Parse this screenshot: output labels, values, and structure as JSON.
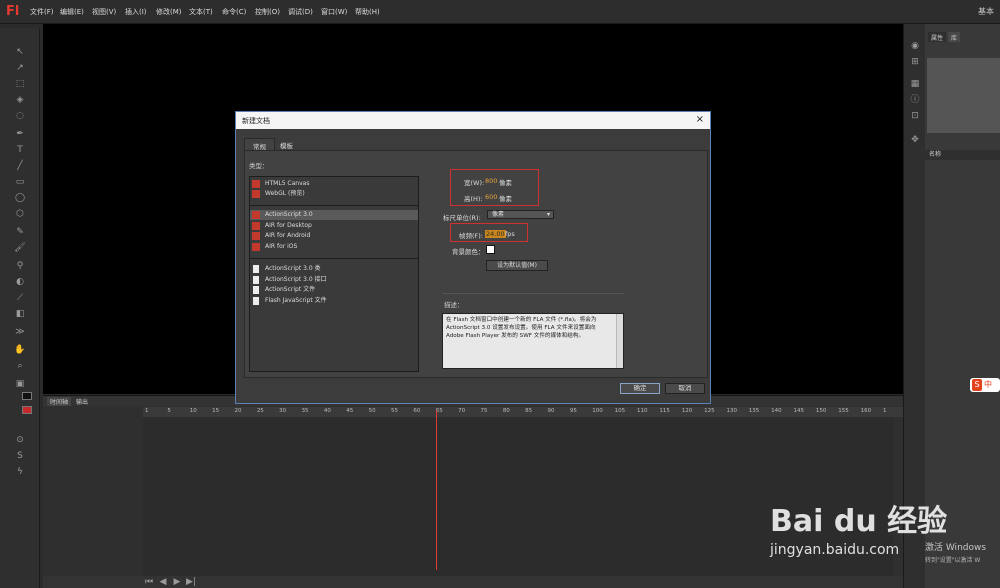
{
  "app": {
    "logo": "Fl",
    "workspace": "基本"
  },
  "menu": [
    "文件(F)",
    "编辑(E)",
    "视图(V)",
    "插入(I)",
    "修改(M)",
    "文本(T)",
    "命令(C)",
    "控制(O)",
    "调试(D)",
    "窗口(W)",
    "帮助(H)"
  ],
  "right_panel": {
    "tabs": [
      "属性",
      "库"
    ],
    "name_header": "名称"
  },
  "timeline": {
    "tabs": [
      "时间轴",
      "输出"
    ],
    "ruler": [
      "1",
      "5",
      "10",
      "15",
      "20",
      "25",
      "30",
      "35",
      "40",
      "45",
      "50",
      "55",
      "60",
      "65",
      "70",
      "75",
      "80",
      "85",
      "90",
      "95",
      "100",
      "105",
      "110",
      "115",
      "120",
      "125",
      "130",
      "135",
      "140",
      "145",
      "150",
      "155",
      "160",
      "1"
    ]
  },
  "dialog": {
    "title": "新建文档",
    "close": "×",
    "tabs": [
      "常规",
      "模板"
    ],
    "type_label": "类型：",
    "types_group1": [
      "HTML5 Canvas",
      "WebGL (预览)"
    ],
    "types_group2": [
      "ActionScript 3.0",
      "AIR for Desktop",
      "AIR for Android",
      "AIR for iOS"
    ],
    "types_group3": [
      "ActionScript 3.0 类",
      "ActionScript 3.0 接口",
      "ActionScript 文件",
      "Flash JavaScript 文件"
    ],
    "width_label": "宽(W):",
    "width_value": "800",
    "width_unit": "像素",
    "height_label": "高(H):",
    "height_value": "600",
    "height_unit": "像素",
    "ruler_label": "标尺单位(R):",
    "ruler_value": "像素",
    "fps_label": "帧频(F):",
    "fps_value": "24.00",
    "fps_unit": "fps",
    "bg_label": "背景颜色：",
    "bg_color": "#ffffff",
    "set_default": "设为默认值(M)",
    "desc_label": "描述：",
    "description": "在 Flash 文档窗口中创建一个新的 FLA 文件 (*.fla)。将会为 ActionScript 3.0 设置发布设置。使用 FLA 文件来设置面向 Adobe Flash Player 发布的 SWF 文件的媒体和结构。",
    "ok": "确定",
    "cancel": "取消"
  },
  "watermark": {
    "logo": "Bai du 经验",
    "url": "jingyan.baidu.com"
  },
  "os_notice": {
    "line1": "激活 Windows",
    "line2": "转到\"设置\"以激活 W"
  },
  "ime": {
    "icon": "S",
    "label": "中"
  },
  "colors": {
    "accent_red": "#d03030",
    "dialog_border": "#5a82b9",
    "value_orange": "#e8a23a"
  }
}
